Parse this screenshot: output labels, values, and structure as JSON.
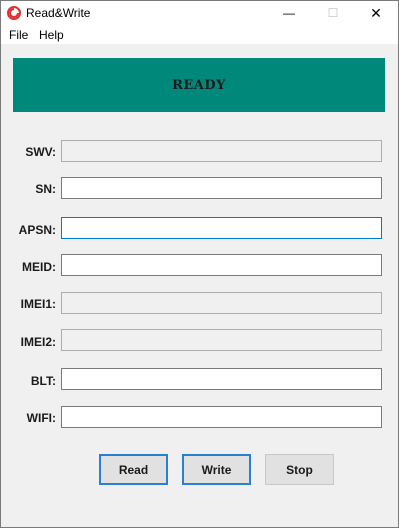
{
  "window": {
    "title": "Read&Write",
    "icon": "app-logo-icon",
    "controls": {
      "minimize": "—",
      "maximize": "☐",
      "close": "✕"
    }
  },
  "menu": {
    "file": "File",
    "help": "Help"
  },
  "status": {
    "text": "READY",
    "color": "#00897b"
  },
  "fields": [
    {
      "label": "SWV:",
      "value": "",
      "readonly": true
    },
    {
      "label": "SN:",
      "value": "",
      "readonly": false
    },
    {
      "label": "APSN:",
      "value": "",
      "readonly": false,
      "focused": true
    },
    {
      "label": "MEID:",
      "value": "",
      "readonly": false
    },
    {
      "label": "IMEI1:",
      "value": "",
      "readonly": true
    },
    {
      "label": "IMEI2:",
      "value": "",
      "readonly": true
    },
    {
      "label": "BLT:",
      "value": "",
      "readonly": false
    },
    {
      "label": "WIFI:",
      "value": "",
      "readonly": false
    }
  ],
  "buttons": {
    "read": "Read",
    "write": "Write",
    "stop": "Stop"
  },
  "colors": {
    "accent": "#2a7fcf",
    "focus": "#0078d7"
  }
}
